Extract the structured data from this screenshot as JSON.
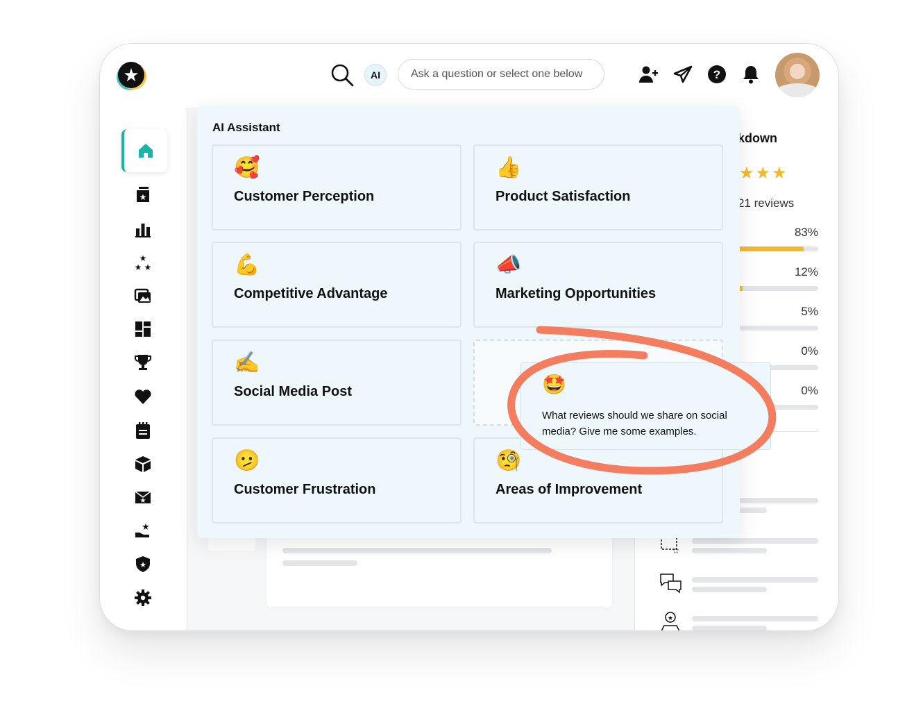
{
  "header": {
    "ai_badge": "AI",
    "ask_placeholder": "Ask a question or select one below"
  },
  "icons": {
    "logo": "star-logo-icon",
    "search": "search-icon",
    "invite": "add-user-icon",
    "send": "send-icon",
    "help": "help-icon",
    "notifications": "bell-icon"
  },
  "sidebar": {
    "items": [
      {
        "name": "home",
        "icon": "home-icon",
        "active": true
      },
      {
        "name": "reviews",
        "icon": "review-box-icon"
      },
      {
        "name": "analytics",
        "icon": "bar-chart-icon"
      },
      {
        "name": "ratings",
        "icon": "stars-icon"
      },
      {
        "name": "media",
        "icon": "gallery-icon"
      },
      {
        "name": "widgets",
        "icon": "dashboard-icon"
      },
      {
        "name": "awards",
        "icon": "trophy-icon"
      },
      {
        "name": "favorites",
        "icon": "heart-icon"
      },
      {
        "name": "notes",
        "icon": "notepad-icon"
      },
      {
        "name": "products",
        "icon": "box-icon"
      },
      {
        "name": "campaigns",
        "icon": "mail-star-icon"
      },
      {
        "name": "endorsements",
        "icon": "hand-star-icon"
      },
      {
        "name": "trust",
        "icon": "shield-star-icon"
      },
      {
        "name": "settings",
        "icon": "gear-icon"
      }
    ]
  },
  "ai_assistant": {
    "title": "AI Assistant",
    "cards": [
      {
        "emoji": "🥰",
        "label": "Customer Perception"
      },
      {
        "emoji": "👍",
        "label": "Product Satisfaction"
      },
      {
        "emoji": "💪",
        "label": "Competitive Advantage"
      },
      {
        "emoji": "📣",
        "label": "Marketing Opportunities"
      },
      {
        "emoji": "✍️",
        "label": "Social Media Post"
      },
      {
        "emoji": "🫤",
        "label": "Customer Frustration"
      },
      {
        "emoji": "🧐",
        "label": "Areas of Improvement"
      }
    ],
    "suggestion": {
      "emoji": "🤩",
      "text": "What reviews should we share on social media? Give me some examples."
    }
  },
  "rating_breakdown": {
    "title_visible": "kdown",
    "stars_visible": "★★★",
    "reviews_visible": "21 reviews",
    "distribution": [
      {
        "percent": "83%",
        "fill": 0.83
      },
      {
        "percent": "12%",
        "fill": 0.12
      },
      {
        "percent": "5%",
        "fill": 0.05
      },
      {
        "percent": "0%",
        "fill": 0
      },
      {
        "percent": "0%",
        "fill": 0
      }
    ]
  },
  "colors": {
    "accent": "#19b3a7",
    "star": "#f2b929",
    "panel": "#eef7fc",
    "annotation": "#f47c5f"
  }
}
